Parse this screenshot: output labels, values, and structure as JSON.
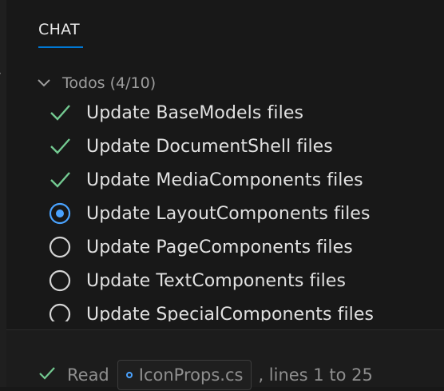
{
  "panel": {
    "tab_label": "CHAT"
  },
  "todos": {
    "header": "Todos (4/10)",
    "items": [
      {
        "label": "Update BaseModels files",
        "status": "completed"
      },
      {
        "label": "Update DocumentShell files",
        "status": "completed"
      },
      {
        "label": "Update MediaComponents files",
        "status": "completed"
      },
      {
        "label": "Update LayoutComponents files",
        "status": "in-progress"
      },
      {
        "label": "Update PageComponents files",
        "status": "not-started"
      },
      {
        "label": "Update TextComponents files",
        "status": "not-started"
      },
      {
        "label": "Update SpecialComponents files",
        "status": "not-started"
      }
    ]
  },
  "read_status": {
    "label": "Read",
    "file_name": "IconProps.cs",
    "range_text": ", lines 1 to 25"
  },
  "colors": {
    "check_green": "#73c991",
    "progress_blue": "#4aa3ff",
    "accent_tab": "#0078d4"
  },
  "icons": {
    "header_toggle": "chevron-down-icon",
    "completed": "check-icon",
    "in_progress": "radio-filled-icon",
    "not_started": "circle-outline-icon",
    "read_status": "check-icon",
    "file": "file-type-icon"
  }
}
